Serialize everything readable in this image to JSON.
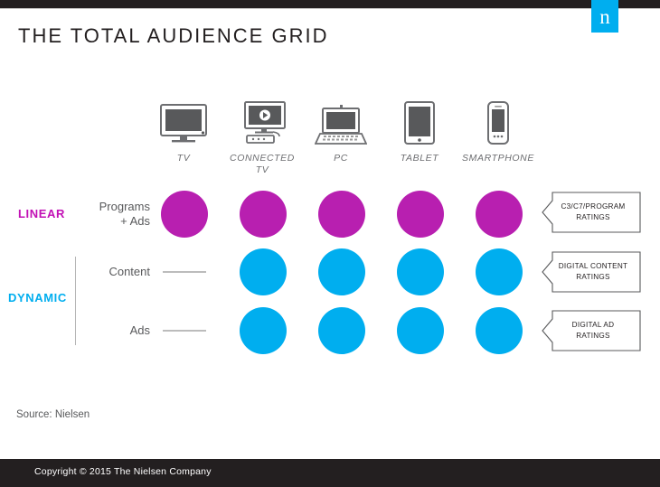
{
  "header": {
    "title": "THE TOTAL AUDIENCE GRID",
    "logo_letter": "n",
    "logo_color": "#00aeef",
    "bar_color": "#231f20"
  },
  "columns": [
    {
      "id": "tv",
      "label": "TV",
      "icon": "tv-icon"
    },
    {
      "id": "connected-tv",
      "label": "CONNECTED\nTV",
      "label_line1": "CONNECTED",
      "label_line2": "TV",
      "icon": "connected-tv-icon"
    },
    {
      "id": "pc",
      "label": "PC",
      "icon": "laptop-icon"
    },
    {
      "id": "tablet",
      "label": "TABLET",
      "icon": "tablet-icon"
    },
    {
      "id": "smartphone",
      "label": "SMARTPHONE",
      "icon": "smartphone-icon"
    }
  ],
  "groups": [
    {
      "id": "linear",
      "label": "LINEAR",
      "color": "#c210b5"
    },
    {
      "id": "dynamic",
      "label": "DYNAMIC",
      "color": "#00aeef"
    }
  ],
  "rows": [
    {
      "id": "programs-ads",
      "group": "linear",
      "label_line1": "Programs",
      "label_line2": "+ Ads",
      "cells": [
        "dot",
        "dot",
        "dot",
        "dot",
        "dot"
      ],
      "dot_color": "#b81fb0"
    },
    {
      "id": "content",
      "group": "dynamic",
      "label_line1": "Content",
      "label_line2": "",
      "cells": [
        "dash",
        "dot",
        "dot",
        "dot",
        "dot"
      ],
      "dot_color": "#00aeef"
    },
    {
      "id": "ads",
      "group": "dynamic",
      "label_line1": "Ads",
      "label_line2": "",
      "cells": [
        "dash",
        "dot",
        "dot",
        "dot",
        "dot"
      ],
      "dot_color": "#00aeef"
    }
  ],
  "callouts": [
    {
      "id": "c3c7",
      "line1": "C3/C7/PROGRAM",
      "line2": "RATINGS"
    },
    {
      "id": "digital-content",
      "line1": "DIGITAL CONTENT",
      "line2": "RATINGS"
    },
    {
      "id": "digital-ad",
      "line1": "DIGITAL AD",
      "line2": "RATINGS"
    }
  ],
  "source": {
    "text": "Source: Nielsen"
  },
  "footer": {
    "text": "Copyright © 2015 The Nielsen Company"
  }
}
